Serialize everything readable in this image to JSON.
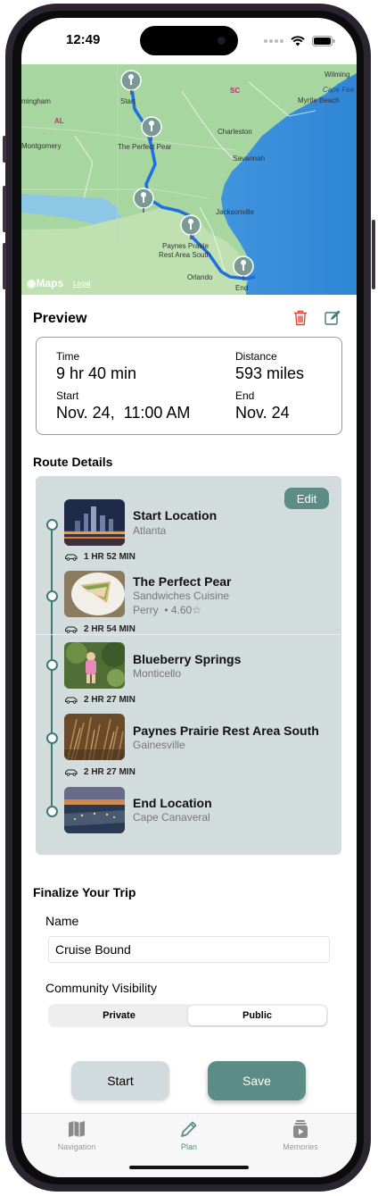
{
  "status": {
    "time": "12:49"
  },
  "map": {
    "brand": "Maps",
    "legal": "Legal",
    "labels": {
      "wilmington": "Wilming",
      "birmingham": "mingham",
      "sc": "SC",
      "cape_fear": "Cape Fea",
      "myrtle": "Myrtle Beach",
      "al": "AL",
      "charleston": "Charleston",
      "montgomery": "Montgomery",
      "savannah": "Savannah",
      "jacksonville": "Jacksonville",
      "orlando": "Orlando",
      "start": "Start",
      "perfect_pear": "The Perfect Pear",
      "paynes_1": "Paynes Prairie",
      "paynes_2": "Rest Area South",
      "end": "End"
    }
  },
  "preview": {
    "title": "Preview",
    "time_label": "Time",
    "time_value": "9 hr 40 min",
    "distance_label": "Distance",
    "distance_value": "593 miles",
    "start_label": "Start",
    "start_value": "Nov. 24,  11:00 AM",
    "end_label": "End",
    "end_value": "Nov. 24"
  },
  "route": {
    "title": "Route Details",
    "edit_label": "Edit",
    "stops": [
      {
        "name": "Start Location",
        "subtitle": "Atlanta"
      },
      {
        "name": "The Perfect Pear",
        "subtitle": "Sandwiches Cuisine",
        "detail": "Perry  • 4.60☆"
      },
      {
        "name": "Blueberry Springs",
        "subtitle": "Monticello"
      },
      {
        "name": "Paynes Prairie Rest Area South",
        "subtitle": "Gainesville"
      },
      {
        "name": "End Location",
        "subtitle": "Cape Canaveral"
      }
    ],
    "drives": [
      "1 HR 52 MIN",
      "2 HR 54 MIN",
      "2 HR 27 MIN",
      "2 HR 27 MIN"
    ]
  },
  "finalize": {
    "title": "Finalize Your Trip",
    "name_label": "Name",
    "name_value": "Cruise Bound",
    "visibility_label": "Community Visibility",
    "visibility_options": [
      "Private",
      "Public"
    ],
    "visibility_selected": "Public"
  },
  "actions": {
    "start_label": "Start",
    "save_label": "Save"
  },
  "tabs": [
    {
      "label": "Navigation",
      "icon": "map-icon"
    },
    {
      "label": "Plan",
      "icon": "pencil-icon"
    },
    {
      "label": "Memories",
      "icon": "memories-icon"
    }
  ],
  "active_tab": "Plan",
  "colors": {
    "accent": "#5b8c86",
    "delete": "#e0453a",
    "route": "#1f6fe0",
    "card": "#d2dcdd"
  }
}
